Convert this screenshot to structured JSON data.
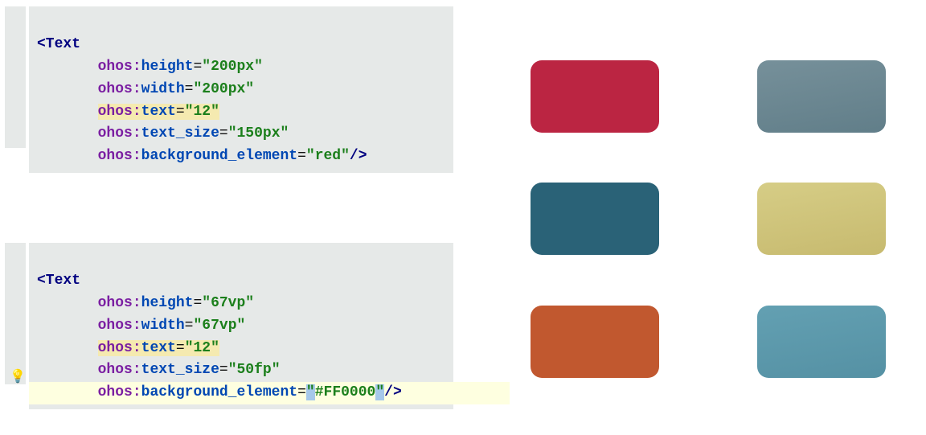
{
  "code1": {
    "tag": "<Text",
    "indent": "       ",
    "a1": {
      "ns": "ohos",
      "attr": "height",
      "val": "\"200px\""
    },
    "a2": {
      "ns": "ohos",
      "attr": "width",
      "val": "\"200px\""
    },
    "a3": {
      "ns": "ohos",
      "attr": "text",
      "val": "\"12\""
    },
    "a4": {
      "ns": "ohos",
      "attr": "text_size",
      "val": "\"150px\""
    },
    "a5": {
      "ns": "ohos",
      "attr": "background_element",
      "val": "\"red\""
    },
    "end": "/>"
  },
  "code2": {
    "tag": "<Text",
    "indent": "       ",
    "a1": {
      "ns": "ohos",
      "attr": "height",
      "val": "\"67vp\""
    },
    "a2": {
      "ns": "ohos",
      "attr": "width",
      "val": "\"67vp\""
    },
    "a3": {
      "ns": "ohos",
      "attr": "text",
      "val": "\"12\""
    },
    "a4": {
      "ns": "ohos",
      "attr": "text_size",
      "val": "\"50fp\""
    },
    "a5": {
      "ns": "ohos",
      "attr": "background_element",
      "val_open": "\"",
      "val_body": "#FF0000",
      "val_close": "\""
    },
    "end": "/>"
  },
  "colon": ":",
  "eq": "=",
  "swatches": {
    "s1": "#bb2542",
    "s2": "#6e8790",
    "s3": "#2a6277",
    "s4": "#cfc47d",
    "s5": "#c1582f",
    "s6": "#5c99ab"
  }
}
